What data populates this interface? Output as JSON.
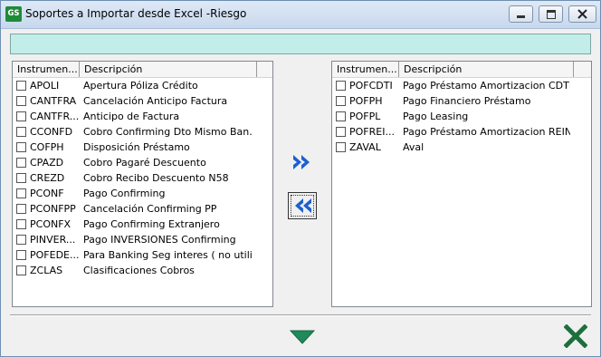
{
  "window": {
    "title": "Soportes a Importar desde Excel -Riesgo",
    "app_icon_text": "GS"
  },
  "left_list": {
    "columns": [
      "Instrumen...",
      "Descripción"
    ],
    "rows": [
      {
        "code": "APOLI",
        "desc": "Apertura Póliza Crédito",
        "checked": false
      },
      {
        "code": "CANTFRA",
        "desc": "Cancelación Anticipo Factura",
        "checked": false
      },
      {
        "code": "CANTFR...",
        "desc": "Anticipo de Factura",
        "checked": false
      },
      {
        "code": "CCONFD",
        "desc": "Cobro Confirming Dto Mismo Ban...",
        "checked": false
      },
      {
        "code": "COFPH",
        "desc": "Disposición Préstamo",
        "checked": false
      },
      {
        "code": "CPAZD",
        "desc": "Cobro Pagaré Descuento",
        "checked": false
      },
      {
        "code": "CREZD",
        "desc": "Cobro Recibo Descuento N58",
        "checked": false
      },
      {
        "code": "PCONF",
        "desc": "Pago Confirming",
        "checked": false
      },
      {
        "code": "PCONFPP",
        "desc": "Cancelación Confirming PP",
        "checked": false
      },
      {
        "code": "PCONFX",
        "desc": "Pago Confirming Extranjero",
        "checked": false
      },
      {
        "code": "PINVER...",
        "desc": "Pago INVERSIONES Confirming",
        "checked": false
      },
      {
        "code": "POFEDE...",
        "desc": "Para Banking Seg interes ( no utili...",
        "checked": false
      },
      {
        "code": "ZCLAS",
        "desc": "Clasificaciones Cobros",
        "checked": false
      }
    ]
  },
  "right_list": {
    "columns": [
      "Instrumen...",
      "Descripción"
    ],
    "rows": [
      {
        "code": "POFCDTI",
        "desc": "Pago Préstamo Amortizacion CDTI",
        "checked": false
      },
      {
        "code": "POFPH",
        "desc": "Pago Financiero Préstamo",
        "checked": false
      },
      {
        "code": "POFPL",
        "desc": "Pago Leasing",
        "checked": false
      },
      {
        "code": "POFREI...",
        "desc": "Pago Préstamo Amortizacion REIN...",
        "checked": false
      },
      {
        "code": "ZAVAL",
        "desc": "Aval",
        "checked": false
      }
    ]
  },
  "icons": {
    "add": "double-chevron-right-icon",
    "remove": "double-chevron-left-icon",
    "accept": "triangle-down-icon",
    "cancel": "x-icon"
  },
  "colors": {
    "arrow_blue": "#1c5fd0",
    "accept_green": "#1f8a5a",
    "cancel_green": "#1d6f3e",
    "info_bar": "#c2ede9"
  }
}
